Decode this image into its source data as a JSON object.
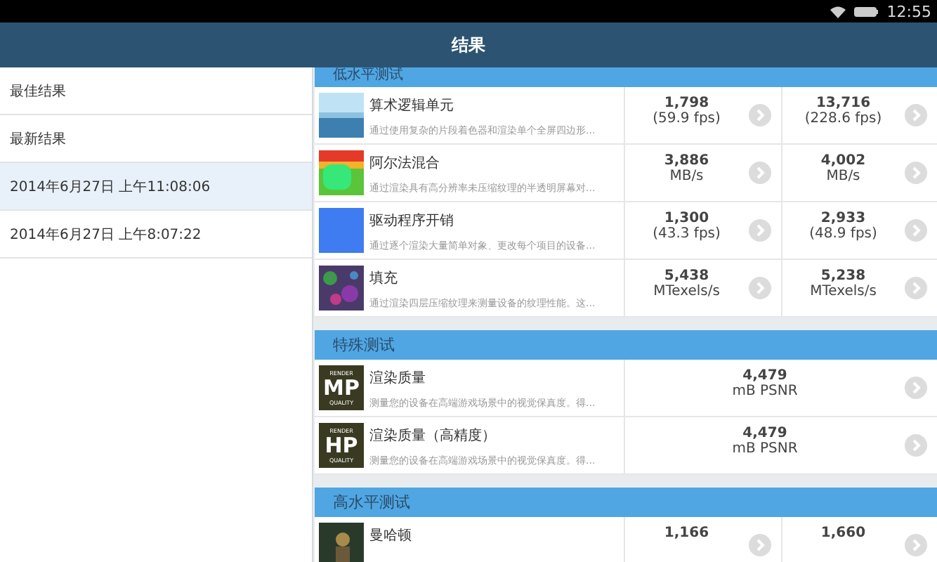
{
  "status_bar": {
    "time": "12:55"
  },
  "title_bar": {
    "title": "结果"
  },
  "sidebar": {
    "items": [
      {
        "label": "最佳结果",
        "selected": false
      },
      {
        "label": "最新结果",
        "selected": false
      },
      {
        "label": "2014年6月27日 上午11:08:06",
        "selected": true
      },
      {
        "label": "2014年6月27日 上午8:07:22",
        "selected": false
      }
    ]
  },
  "sections": [
    {
      "title": "低水平测试",
      "cut": true,
      "rows": [
        {
          "kind": "sky",
          "name": "算术逻辑单元",
          "description": "通过使用复杂的片段着色器和渲染单个全屏四边形...",
          "scores": [
            {
              "value": "1,798",
              "unit": "(59.9 fps)"
            },
            {
              "value": "13,716",
              "unit": "(228.6 fps)"
            }
          ]
        },
        {
          "kind": "blend",
          "name": "阿尔法混合",
          "description": "通过渲染具有高分辨率未压缩纹理的半透明屏幕对...",
          "scores": [
            {
              "value": "3,886",
              "unit": "MB/s"
            },
            {
              "value": "4,002",
              "unit": "MB/s"
            }
          ]
        },
        {
          "kind": "solid",
          "name": "驱动程序开销",
          "description": "通过逐个渲染大量简单对象、更改每个项目的设备...",
          "scores": [
            {
              "value": "1,300",
              "unit": "(43.3 fps)"
            },
            {
              "value": "2,933",
              "unit": "(48.9 fps)"
            }
          ]
        },
        {
          "kind": "noise",
          "name": "填充",
          "description": "通过渲染四层压缩纹理来测量设备的纹理性能。这...",
          "scores": [
            {
              "value": "5,438",
              "unit": "MTexels/s"
            },
            {
              "value": "5,238",
              "unit": "MTexels/s"
            }
          ]
        }
      ]
    },
    {
      "title": "特殊测试",
      "cut": false,
      "rows": [
        {
          "kind": "badge",
          "badge": {
            "top": "RENDER",
            "main": "MP",
            "bottom": "QUALITY"
          },
          "name": "渲染质量",
          "description": "测量您的设备在高端游戏场景中的视觉保真度。得...",
          "scores": [
            {
              "value": "4,479",
              "unit": "mB PSNR"
            }
          ]
        },
        {
          "kind": "badge",
          "badge": {
            "top": "RENDER",
            "main": "HP",
            "bottom": "QUALITY"
          },
          "name": "渲染质量（高精度）",
          "description": "测量您的设备在高端游戏场景中的视觉保真度。得...",
          "scores": [
            {
              "value": "4,479",
              "unit": "mB PSNR"
            }
          ]
        }
      ]
    },
    {
      "title": "高水平测试",
      "cut": false,
      "rows": [
        {
          "kind": "figure",
          "name": "曼哈顿",
          "scores": [
            {
              "value": "1,166"
            },
            {
              "value": "1,660"
            }
          ]
        }
      ]
    }
  ]
}
